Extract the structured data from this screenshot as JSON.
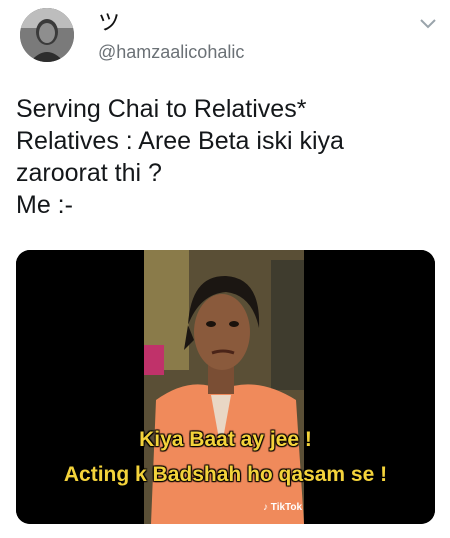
{
  "tweet": {
    "display_name": "ツ",
    "handle": "@hamzaalicohalic",
    "text_lines": [
      "Serving Chai to Relatives*",
      "Relatives : Aree Beta iski kiya",
      "zaroorat thi ?",
      "Me :-"
    ],
    "icons": {
      "avatar": "user-avatar",
      "menu": "chevron-down-icon"
    }
  },
  "media": {
    "caption_line1": "Kiya Baat ay jee !",
    "caption_line2": "Acting k Badshah ho qasam se !",
    "watermark": "TikTok",
    "caption_color": "#f4d33b"
  }
}
